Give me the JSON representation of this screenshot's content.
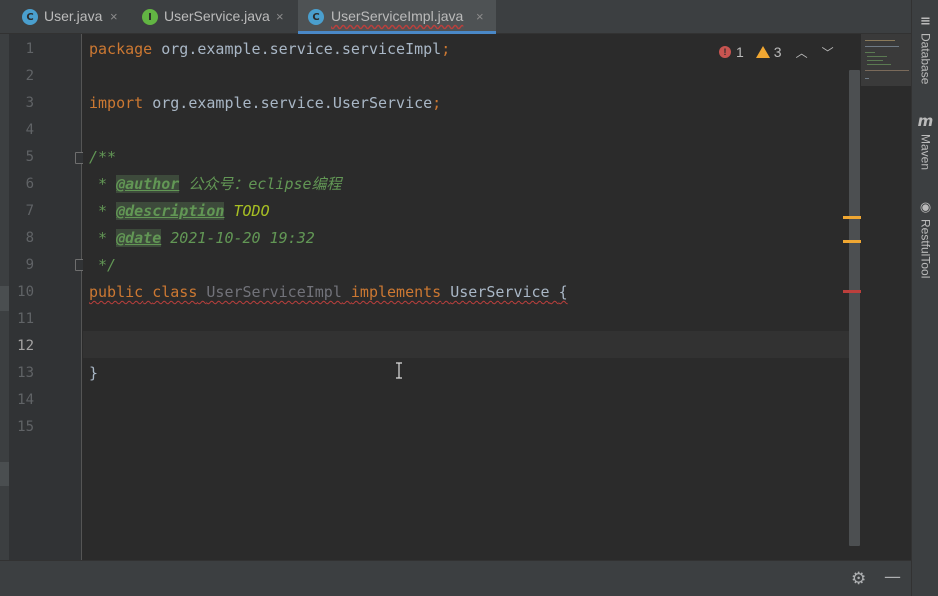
{
  "tabs": [
    {
      "label": "User.java",
      "icon": "class-icon",
      "icon_letter": "C",
      "active": false
    },
    {
      "label": "UserService.java",
      "icon": "interface-icon",
      "icon_letter": "I",
      "active": false
    },
    {
      "label": "UserServiceImpl.java",
      "icon": "class-icon",
      "icon_letter": "C",
      "active": true
    }
  ],
  "close_glyph": "×",
  "line_numbers": [
    "1",
    "2",
    "3",
    "4",
    "5",
    "6",
    "7",
    "8",
    "9",
    "10",
    "11",
    "12",
    "13",
    "14",
    "15"
  ],
  "current_line": "12",
  "code": {
    "l1_kw": "package",
    "l1_rest": " org.example.service.serviceImpl",
    "l1_semi": ";",
    "l3_kw": "import",
    "l3_rest": " org.example.service.UserService",
    "l3_semi": ";",
    "l5": "/**",
    "l6_star": " * ",
    "l6_tag": "@author",
    "l6_text": " 公众号：eclipse编程",
    "l7_star": " * ",
    "l7_tag": "@description",
    "l7_todo": " TODO",
    "l8_star": " * ",
    "l8_tag": "@date",
    "l8_text": " 2021-10-20 19:32",
    "l9": " */",
    "l10_kw1": "public",
    "l10_kw2": "class",
    "l10_name": "UserServiceImpl",
    "l10_kw3": "implements",
    "l10_iface": "UserService",
    "l10_brace": "{",
    "l13": "}"
  },
  "inspections": {
    "errors": "1",
    "warnings": "3",
    "error_glyph": "!",
    "up": "︿",
    "down": "﹀"
  },
  "right_tools": [
    {
      "label": "Database",
      "icon": "database-icon",
      "glyph": "≡"
    },
    {
      "label": "Maven",
      "icon": "maven-icon",
      "glyph": "m"
    },
    {
      "label": "RestfulTool",
      "icon": "restful-tool-icon",
      "glyph": "◉"
    }
  ],
  "bottom": {
    "settings_glyph": "⚙",
    "hide_glyph": "—"
  },
  "colors": {
    "keyword": "#cc7832",
    "doc": "#629755",
    "todo": "#a8c023",
    "error": "#bc3f3c",
    "warning": "#f0a732"
  }
}
